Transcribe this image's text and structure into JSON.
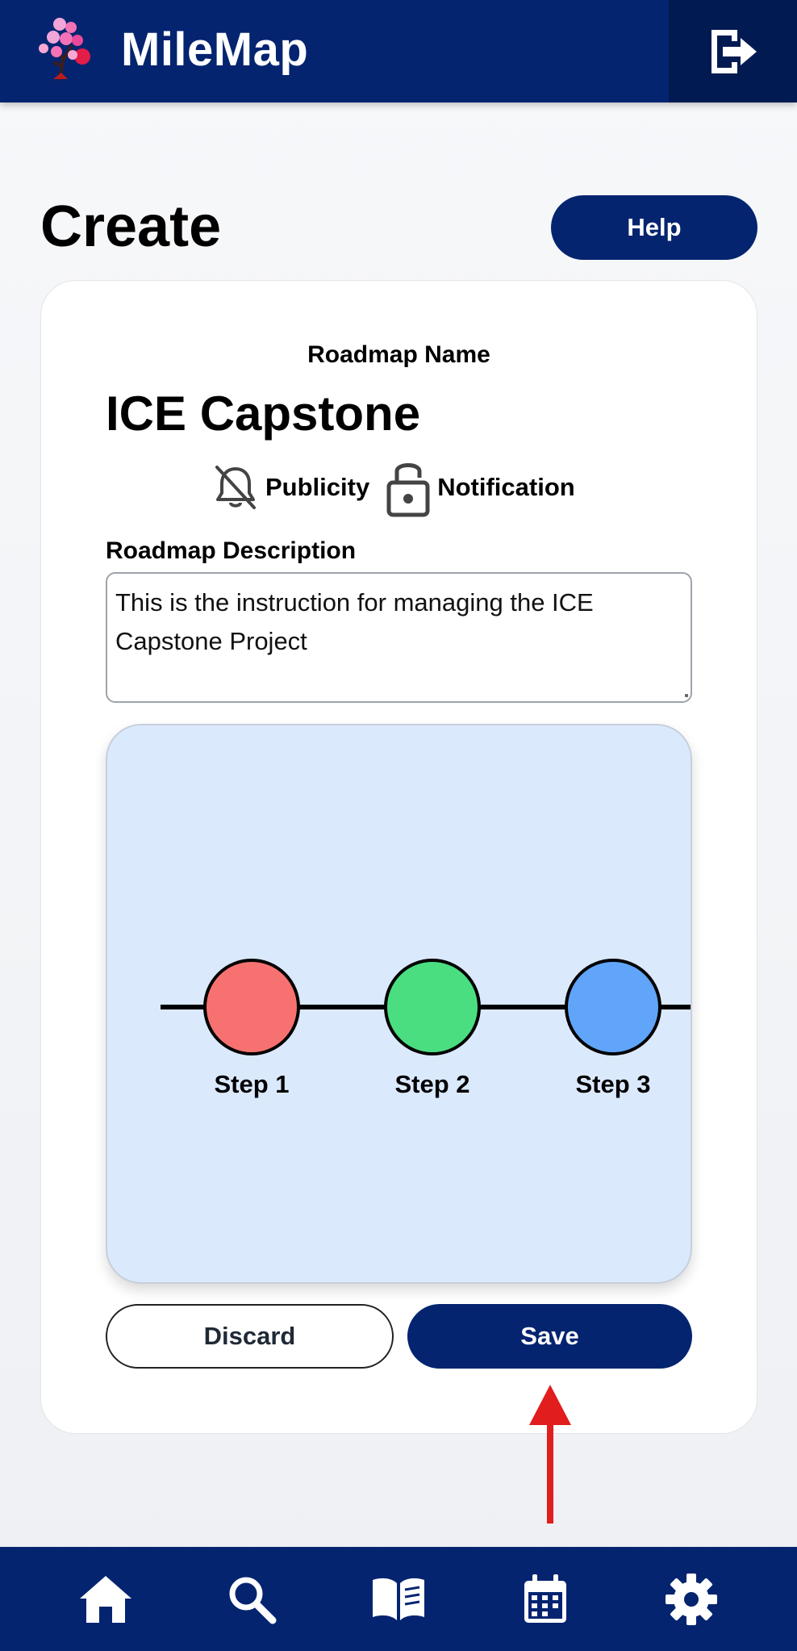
{
  "header": {
    "brand": "MileMap",
    "logo_icon": "blossom-tree-logo",
    "logout_icon": "logout-icon"
  },
  "page": {
    "title": "Create",
    "help_label": "Help"
  },
  "form": {
    "name_label": "Roadmap Name",
    "name_value": "ICE Capstone",
    "toggles": [
      {
        "icon": "bell-off-icon",
        "label": "Publicity"
      },
      {
        "icon": "lock-open-icon",
        "label": "Notification"
      }
    ],
    "description_label": "Roadmap Description",
    "description_value": "This is the instruction for managing the ICE Capstone Project"
  },
  "diagram": {
    "steps": [
      {
        "label": "Step 1",
        "color": "#f87171"
      },
      {
        "label": "Step 2",
        "color": "#4ade80"
      },
      {
        "label": "Step 3",
        "color": "#60a5fa"
      }
    ],
    "background": "#dbe9fd"
  },
  "actions": {
    "discard_label": "Discard",
    "save_label": "Save"
  },
  "annotation": {
    "arrow_color": "#e11d1d",
    "arrow_icon": "up-arrow-annotation"
  },
  "nav": {
    "items": [
      {
        "icon": "home-icon"
      },
      {
        "icon": "search-icon"
      },
      {
        "icon": "book-icon"
      },
      {
        "icon": "calendar-icon"
      },
      {
        "icon": "gear-icon"
      }
    ]
  },
  "colors": {
    "primary": "#042470",
    "primary_dark": "#021a52"
  }
}
